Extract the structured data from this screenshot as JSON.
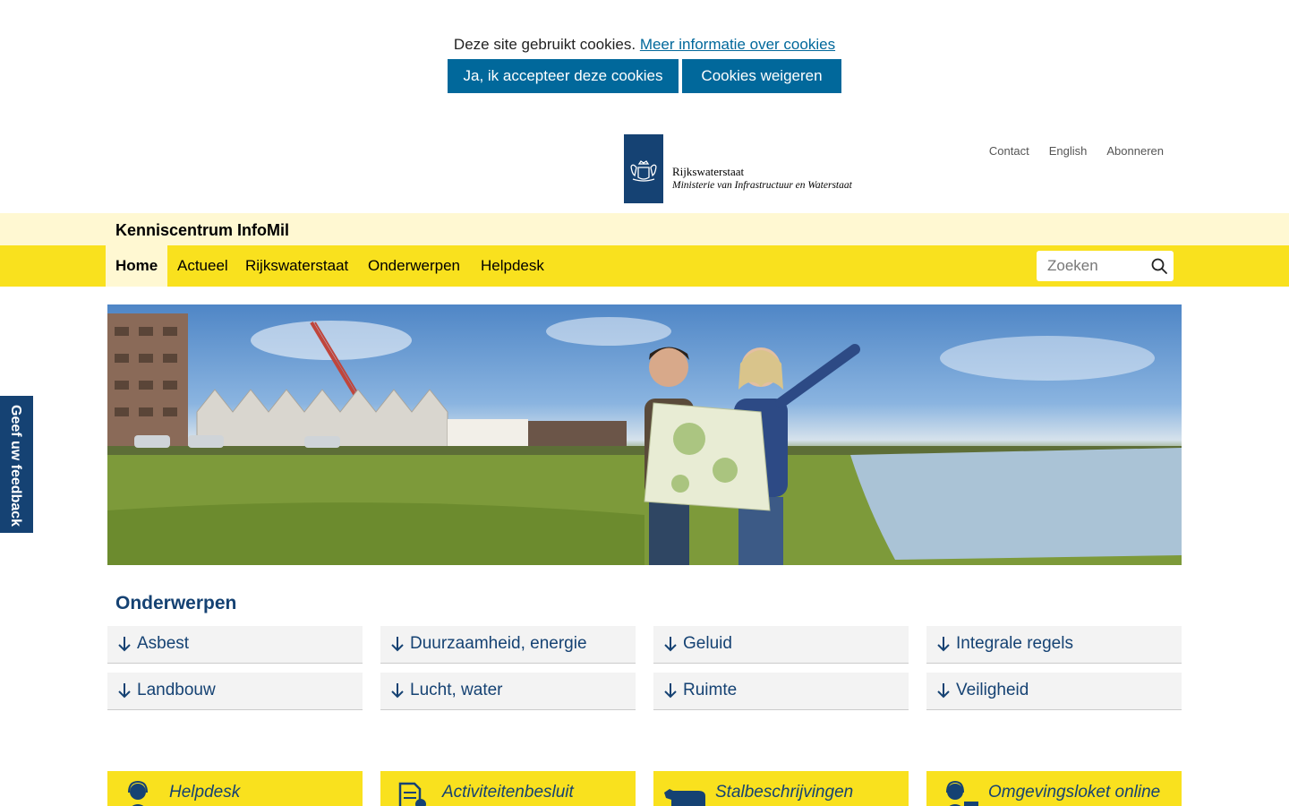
{
  "cookie_bar": {
    "text": "Deze site gebruikt cookies.",
    "link": "Meer informatie over cookies",
    "accept_label": "Ja, ik accepteer deze cookies",
    "decline_label": "Cookies weigeren"
  },
  "logo": {
    "name": "Rijkswaterstaat",
    "ministry": "Ministerie van Infrastructuur en Waterstaat"
  },
  "toplinks": [
    "Contact",
    "English",
    "Abonneren"
  ],
  "site_title": "Kenniscentrum InfoMil",
  "nav": {
    "items": [
      "Home",
      "Actueel",
      "Rijkswaterstaat",
      "Onderwerpen",
      "Helpdesk"
    ],
    "active": "Home"
  },
  "search": {
    "placeholder": "Zoeken"
  },
  "feedback": {
    "label": "Geef uw feedback"
  },
  "topics": {
    "title": "Onderwerpen",
    "items": [
      "Asbest",
      "Duurzaamheid, energie",
      "Geluid",
      "Integrale regels",
      "Landbouw",
      "Lucht, water",
      "Ruimte",
      "Veiligheid"
    ]
  },
  "tiles": [
    {
      "label": "Helpdesk",
      "icon": "person-headset-icon"
    },
    {
      "label": "Activiteitenbesluit",
      "icon": "document-icon"
    },
    {
      "label": "Stalbeschrijvingen",
      "icon": "cow-icon"
    },
    {
      "label": "Omgevingsloket online",
      "icon": "person-computer-icon"
    }
  ],
  "colors": {
    "brand_blue": "#154273",
    "link_blue": "#01689b",
    "nav_yellow": "#f9e11e",
    "band_light_yellow": "#fff8d2"
  }
}
